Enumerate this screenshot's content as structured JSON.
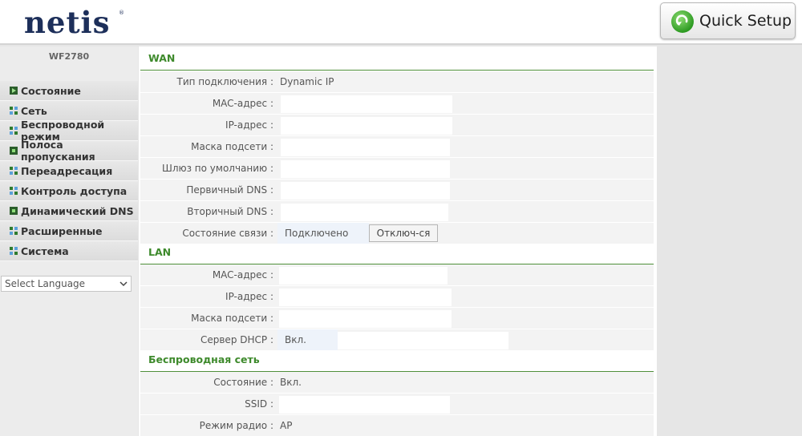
{
  "header": {
    "logo_text": "netis",
    "logo_tm": "®",
    "quick_setup_label": "Quick Setup"
  },
  "sidebar": {
    "model": "WF2780",
    "items": [
      {
        "label": "Состояние",
        "icon": "arrow-icon"
      },
      {
        "label": "Сеть",
        "icon": "grid-icon"
      },
      {
        "label": "Беспроводной режим",
        "icon": "grid-icon"
      },
      {
        "label": "Полоса пропускания",
        "icon": "dot-icon"
      },
      {
        "label": "Переадресация",
        "icon": "grid-icon"
      },
      {
        "label": "Контроль доступа",
        "icon": "grid-icon"
      },
      {
        "label": "Динамический DNS",
        "icon": "dot-icon"
      },
      {
        "label": "Расширенные",
        "icon": "grid-icon"
      },
      {
        "label": "Система",
        "icon": "grid-icon"
      }
    ],
    "language_select": "Select Language"
  },
  "wan": {
    "title": "WAN",
    "connection_type_label": "Тип подключения :",
    "connection_type_value": "Dynamic IP",
    "mac_label": "MAC-адрес :",
    "ip_label": "IP-адрес :",
    "mask_label": "Маска подсети :",
    "gateway_label": "Шлюз по умолчанию :",
    "dns1_label": "Первичный DNS :",
    "dns2_label": "Вторичный DNS :",
    "link_status_label": "Состояние связи :",
    "link_status_value": "Подключено",
    "disconnect_button": "Отключ-ся"
  },
  "lan": {
    "title": "LAN",
    "mac_label": "MAC-адрес :",
    "ip_label": "IP-адрес :",
    "mask_label": "Маска подсети :",
    "dhcp_label": "Сервер DHCP :",
    "dhcp_value": "Вкл."
  },
  "wireless": {
    "title": "Беспроводная сеть",
    "status_label": "Состояние :",
    "status_value": "Вкл.",
    "ssid_label": "SSID :",
    "radio_mode_label": "Режим радио :",
    "radio_mode_value": "AP"
  },
  "colors": {
    "section_title": "#3e8a2c",
    "logo": "#1d2f5a",
    "row_bg": "#f3f3f3"
  }
}
